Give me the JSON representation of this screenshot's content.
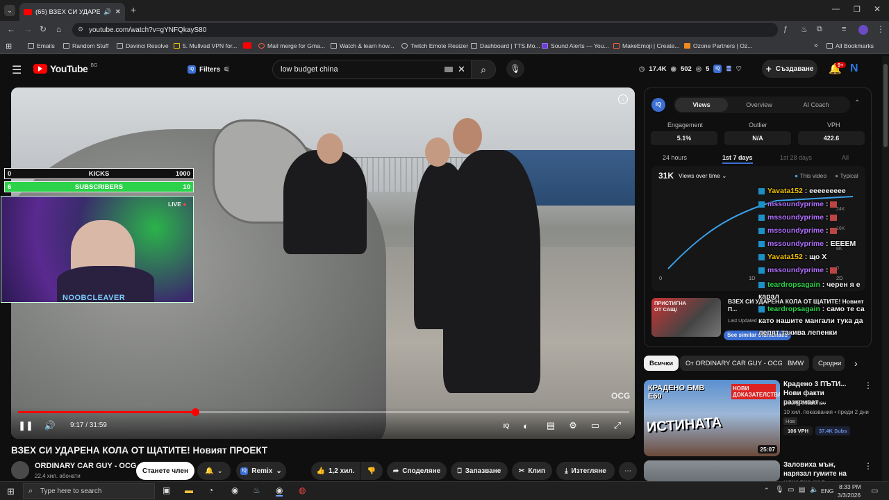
{
  "browser": {
    "tab_title": "(65) ВЗЕХ СИ УДАРЕНА КО",
    "url": "youtube.com/watch?v=gYNFQkayS80",
    "bookmarks": [
      "Emails",
      "Random Stuff",
      "Davinci Resolve",
      "5. Mullvad VPN for...",
      "Mail merge for Gma...",
      "Watch & learn how...",
      "Twitch Emote Resizer",
      "Dashboard | TTS.Mo...",
      "Sound Alerts — You...",
      "MakeEmoji | Create...",
      "Ozone Partners | Oz..."
    ],
    "all_bookmarks": "All Bookmarks"
  },
  "youtube": {
    "logo": "YouTube",
    "country": "BG",
    "filters": "Filters",
    "search_query": "low budget china",
    "stats": {
      "a": "17.4K",
      "b": "502",
      "c": "5"
    },
    "create": "Създаване",
    "notif_count": "9+",
    "avatar_letter": "N"
  },
  "player": {
    "time": "9:17 / 31:59",
    "progress_fraction": 0.29,
    "watermark": "OCG",
    "overlay_kicks": {
      "left": "0",
      "label": "KICKS",
      "right": "1000"
    },
    "overlay_subs": {
      "left": "6",
      "label": "SUBSCRIBERS",
      "right": "10"
    },
    "live_badge": "LIVE",
    "streamer": "NOOBCLEAVER"
  },
  "video": {
    "title": "ВЗЕХ СИ УДАРЕНА КОЛА ОТ ЩАТИТЕ! Новият ПРОЕКТ",
    "channel": "ORDINARY CAR GUY - OCG",
    "subscribers": "22,4 хил. абонати",
    "join": "Станете член",
    "remix": "Remix",
    "likes": "1,2 хил.",
    "share": "Споделяне",
    "save": "Запазване",
    "clip": "Клип",
    "download": "Изтегляне"
  },
  "iq_panel": {
    "badge": "IQ",
    "tabs": [
      "Views",
      "Overview",
      "AI Coach"
    ],
    "metric_labels": [
      "Engagement",
      "Outlier",
      "VPH"
    ],
    "metric_values": [
      "5.1%",
      "N/A",
      "422.6"
    ],
    "ranges": [
      "24 hours",
      "1st 7 days",
      "1st 28 days",
      "All"
    ],
    "chart_total": "31K",
    "chart_selector": "Views over time",
    "legend": [
      "This video",
      "Typical"
    ],
    "y_ticks": [
      "24K",
      "16K",
      "8K",
      "0"
    ],
    "x_ticks": [
      "0",
      "1D",
      "2D"
    ],
    "similar_title": "ВЗЕХ СИ УДАРЕНА КОЛА ОТ ЩАТИТЕ! Новият П...",
    "similar_sub": "Last Updated",
    "similar_button": "See similar thumbnails",
    "similar_thumb_text": "ПРИСТИГНА ОТ САЩ!"
  },
  "chat": [
    {
      "user": "Yavata152",
      "msg": "eeeeeeeee",
      "color": "#f0c000"
    },
    {
      "user": "mssoundyprime",
      "msg": "",
      "color": "#b070ff"
    },
    {
      "user": "mssoundyprime",
      "msg": "",
      "color": "#b070ff"
    },
    {
      "user": "mssoundyprime",
      "msg": "",
      "color": "#b070ff"
    },
    {
      "user": "mssoundyprime",
      "msg": "EEEEM",
      "color": "#b070ff"
    },
    {
      "user": "Yavata152",
      "msg": "що Х",
      "color": "#f0c000"
    },
    {
      "user": "mssoundyprime",
      "msg": "",
      "color": "#b070ff"
    },
    {
      "user": "teardropsagain",
      "msg": "черен я е карал",
      "color": "#2bd24a"
    },
    {
      "user": "teardropsagain",
      "msg": "само те са като нашите мангали тука да лепят такива лепенки",
      "color": "#2bd24a"
    }
  ],
  "chips": [
    "Всички",
    "От ORDINARY CAR GUY - OCG",
    "BMW",
    "Сродни"
  ],
  "recommendations": [
    {
      "title": "Крадено 3 ПЪТИ... Нови факти разкриват ...",
      "channel": "Georgi Mladenov",
      "meta": "10 хил. показвания • преди 2 дни",
      "badge": "Нов",
      "vph": "106 VPH",
      "subs": "37.4K Subs",
      "duration": "25:07",
      "thumb_text": "ИСТИНАТА",
      "thumb_top": "КРАДЕНО БМВ Е60",
      "thumb_tag": "НОВИ ДОКАЗАТЕЛСТВА"
    },
    {
      "title": "Заловиха мъж, нарязал гумите на няколко кол...",
      "channel": "",
      "meta": ""
    }
  ],
  "taskbar": {
    "search": "Type here to search",
    "time": "8:33 PM",
    "date": "3/3/2026",
    "lang": "ENG"
  }
}
